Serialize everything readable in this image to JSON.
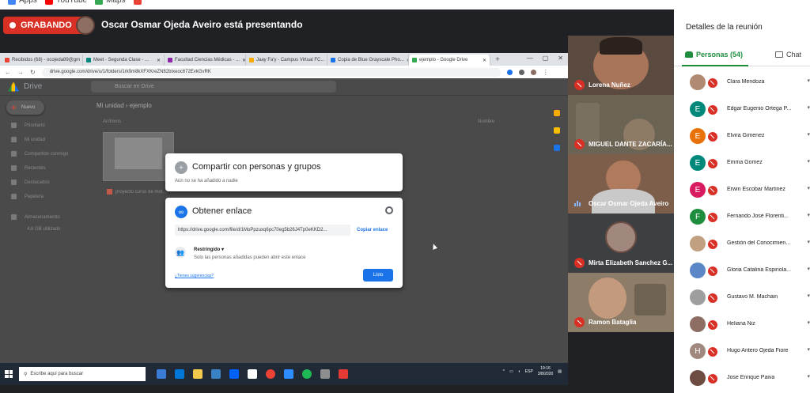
{
  "bookmarks": [
    {
      "label": "Apps",
      "color": "#4285f4"
    },
    {
      "label": "YouTube",
      "color": "#ff0000"
    },
    {
      "label": "Maps",
      "color": "#34a853"
    },
    {
      "label": "",
      "color": "#ea4335"
    }
  ],
  "recording": {
    "label": "GRABANDO"
  },
  "presenter": {
    "text": "Oscar Osmar Ojeda Aveiro está presentando"
  },
  "shared_screen": {
    "tabs": [
      {
        "label": "Recibidos (68) - ocojeda89@gm",
        "color": "#ea4335"
      },
      {
        "label": "Meet - Segunda Clase - ...",
        "color": "#00897b"
      },
      {
        "label": "Facultad Ciencias Médicas - ...",
        "color": "#8e24aa"
      },
      {
        "label": "Jaay Fa'y - Campus Virtual FC...",
        "color": "#f9ab00"
      },
      {
        "label": "Copia de Blue Grayscale Pho...",
        "color": "#1a73e8"
      },
      {
        "label": "ejemplo - Google Drive",
        "color": "#34a853"
      }
    ],
    "new_tab": "+",
    "window_controls": [
      "—",
      "▢",
      "✕"
    ],
    "url": "drive.google.com/drive/u/1/folders/1rk9m8kXFXKreZN82btxeoc672EvkGvRK",
    "drive": {
      "app_name": "Drive",
      "search_placeholder": "Buscar en Drive",
      "new_label": "Nuevo",
      "sidebar": [
        "Prioritario",
        "Mi unidad",
        "Compartido conmigo",
        "Recientes",
        "Destacados",
        "Papelera",
        "Almacenamiento",
        "4,8 GB utilizado"
      ],
      "breadcrumb": "Mi unidad  ›  ejemplo",
      "section_label": "Archivos",
      "sort_label": "Nombre",
      "file_name": "proyecto curso de met..."
    },
    "share_dialog": {
      "title": "Compartir con personas y grupos",
      "subtitle": "Aún no se ha añadido a nadie"
    },
    "link_dialog": {
      "title": "Obtener enlace",
      "url": "https://drive.google.com/file/d/1MoPpzuxq6pc70eg5b26J4Tp0eKKD2...",
      "copy_label": "Copiar enlace",
      "access_label": "Restringido",
      "access_desc": "Solo las personas añadidas pueden abrir este enlace",
      "feedback_label": "¿Tienes sugerencias?",
      "done_label": "Listo"
    },
    "taskbar": {
      "search_placeholder": "Escribe aquí para buscar",
      "lang": "ESP",
      "time": "19:16",
      "date": "3/8/2020"
    }
  },
  "tiles": [
    {
      "name": "Lorena Nuñez",
      "state": "muted",
      "bg": "#5a4a3f"
    },
    {
      "name": "MIGUEL DANTE ZACARÍA...",
      "state": "muted",
      "bg": "#6b6455"
    },
    {
      "name": "Oscar Osmar Ojeda Aveiro",
      "state": "speaking",
      "bg": "#7d5e4b"
    },
    {
      "name": "Mirta Elizabeth Sanchez G...",
      "state": "muted",
      "bg": "#3c4043"
    },
    {
      "name": "Ramon Bataglia",
      "state": "muted",
      "bg": "#8c7c68"
    }
  ],
  "panel": {
    "title": "Detalles de la reunión",
    "people_tab": "Personas (54)",
    "chat_tab": "Chat",
    "participants": [
      {
        "name": "Clara Mendoza",
        "initial": "",
        "color": "#b08a72"
      },
      {
        "name": "Edgar Eugenio Ortega P...",
        "initial": "E",
        "color": "#00897b"
      },
      {
        "name": "Elvira Gimenez",
        "initial": "E",
        "color": "#e8710a"
      },
      {
        "name": "Emma Gomez",
        "initial": "E",
        "color": "#00897b"
      },
      {
        "name": "Erwin Escobar Martinez",
        "initial": "E",
        "color": "#d81b60"
      },
      {
        "name": "Fernando José Florenti...",
        "initial": "F",
        "color": "#1e8e3e"
      },
      {
        "name": "Gestión del Conocimien...",
        "initial": "",
        "color": "#c0a080"
      },
      {
        "name": "Gloria Catalina Espinola...",
        "initial": "",
        "color": "#5b87c7"
      },
      {
        "name": "Gustavo M. Machain",
        "initial": "",
        "color": "#9e9e9e"
      },
      {
        "name": "Heliana Niz",
        "initial": "",
        "color": "#8d6e63"
      },
      {
        "name": "Hugo Antero Ojeda Fiore",
        "initial": "H",
        "color": "#a1887f"
      },
      {
        "name": "Jose Enrique Paiva",
        "initial": "",
        "color": "#6d4c41"
      }
    ]
  }
}
